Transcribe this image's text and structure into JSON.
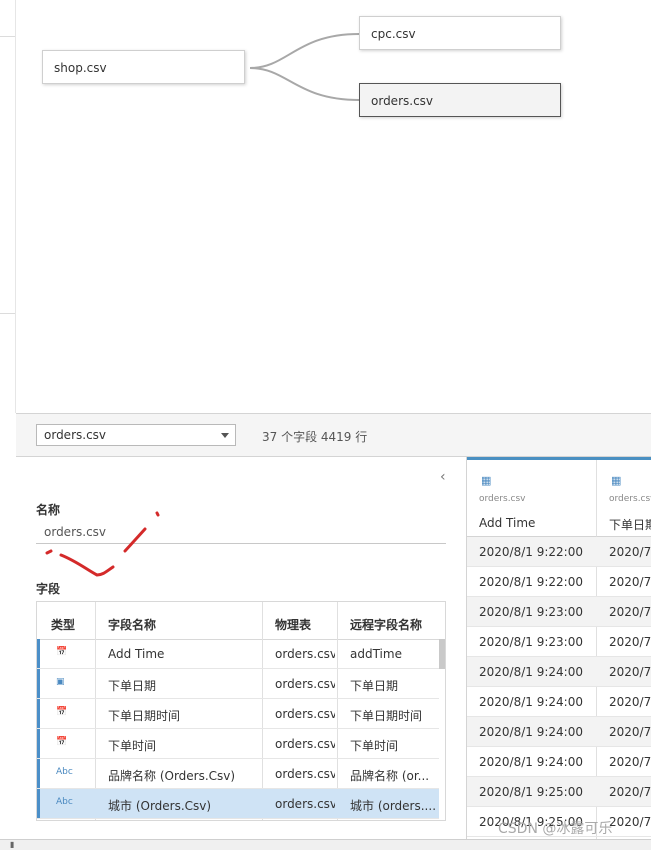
{
  "canvas": {
    "nodes": [
      "shop.csv",
      "cpc.csv",
      "orders.csv"
    ]
  },
  "bar": {
    "selected_table": "orders.csv",
    "stats": "37 个字段 4419 行"
  },
  "meta": {
    "name_label": "名称",
    "name_value": "orders.csv",
    "fields_label": "字段",
    "columns": [
      "类型",
      "字段名称",
      "物理表",
      "远程字段名称"
    ],
    "rows": [
      {
        "type_icon": "datetime-icon",
        "type_glyph": "📅",
        "name": "Add Time",
        "table": "orders.csv",
        "remote": "addTime"
      },
      {
        "type_icon": "date-icon",
        "type_glyph": "▣",
        "name": "下单日期",
        "table": "orders.csv",
        "remote": "下单日期"
      },
      {
        "type_icon": "datetime-icon",
        "type_glyph": "📅",
        "name": "下单日期时间",
        "table": "orders.csv",
        "remote": "下单日期时间"
      },
      {
        "type_icon": "datetime-icon",
        "type_glyph": "📅",
        "name": "下单时间",
        "table": "orders.csv",
        "remote": "下单时间"
      },
      {
        "type_icon": "string-icon",
        "type_glyph": "Abc",
        "name": "品牌名称 (Orders.Csv)",
        "table": "orders.csv",
        "remote": "品牌名称 (or..."
      },
      {
        "type_icon": "string-icon",
        "type_glyph": "Abc",
        "name": "城市 (Orders.Csv)",
        "table": "orders.csv",
        "remote": "城市 (orders...."
      }
    ]
  },
  "grid": {
    "columns": [
      {
        "source": "orders.csv",
        "name": "Add Time"
      },
      {
        "source": "orders.csv",
        "name": "下单日期"
      }
    ],
    "rows": [
      [
        "2020/8/1 9:22:00",
        "2020/7"
      ],
      [
        "2020/8/1 9:22:00",
        "2020/7"
      ],
      [
        "2020/8/1 9:23:00",
        "2020/7"
      ],
      [
        "2020/8/1 9:23:00",
        "2020/7"
      ],
      [
        "2020/8/1 9:24:00",
        "2020/7"
      ],
      [
        "2020/8/1 9:24:00",
        "2020/7"
      ],
      [
        "2020/8/1 9:24:00",
        "2020/7"
      ],
      [
        "2020/8/1 9:24:00",
        "2020/7"
      ],
      [
        "2020/8/1 9:25:00",
        "2020/7"
      ],
      [
        "2020/8/1 9:25:00",
        "2020/7"
      ]
    ]
  },
  "watermark": "CSDN @冰露可乐"
}
